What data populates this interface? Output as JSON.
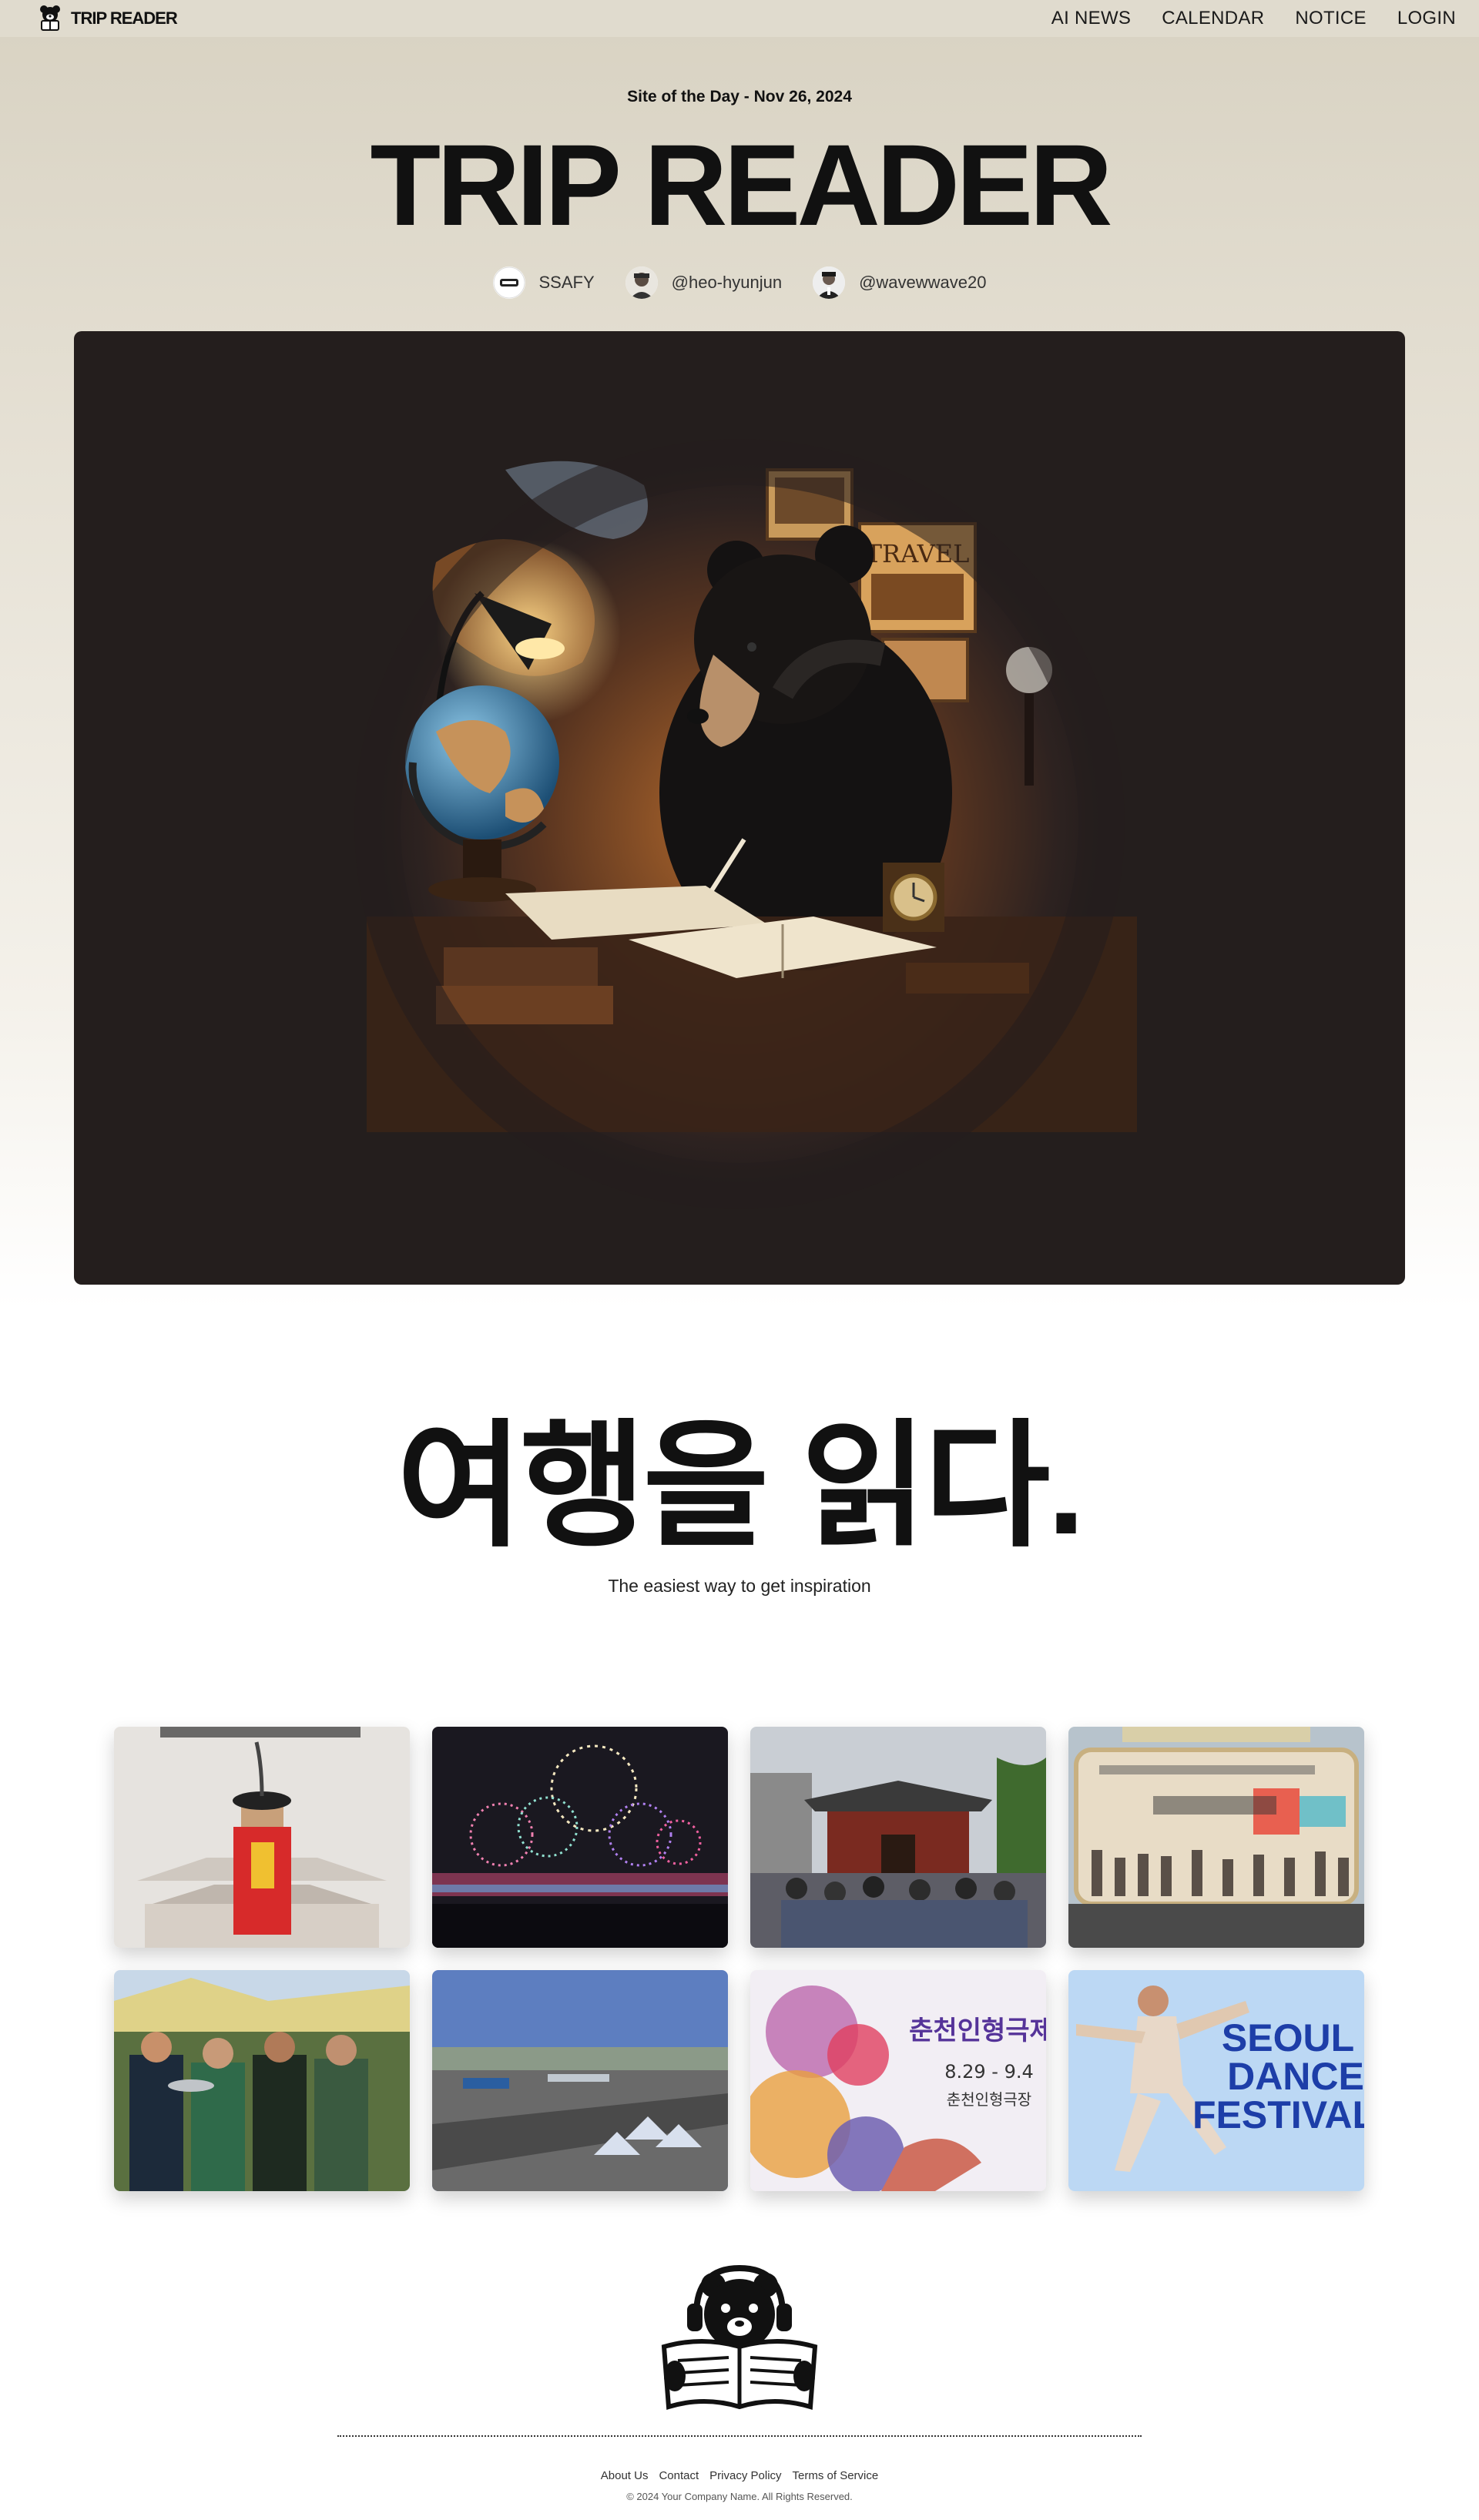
{
  "nav": {
    "brand": "TRIP READER",
    "brand_icon": "bear-reader-icon",
    "links": [
      "AI NEWS",
      "CALENDAR",
      "NOTICE",
      "LOGIN"
    ]
  },
  "hero": {
    "site_of_day": "Site of the Day - Nov 26, 2024",
    "title": "TRIP READER",
    "credits": [
      {
        "name": "SSAFY",
        "avatar": "ssafy-logo"
      },
      {
        "name": "@heo-hyunjun",
        "avatar": "user-photo"
      },
      {
        "name": "@wavewwave20",
        "avatar": "user-photo"
      }
    ],
    "image": {
      "description_icon": "bear-reading-at-desk-illustration",
      "poster_word": "TRAVEL"
    }
  },
  "tagline": {
    "headline": "여행을 읽다.",
    "sub": "The easiest way to get inspiration"
  },
  "gallery": {
    "cards": [
      {
        "icon": "traditional-guard-festival-photo"
      },
      {
        "icon": "fireworks-festival-photo"
      },
      {
        "icon": "palace-gate-crowd-photo"
      },
      {
        "icon": "kids-stage-event-photo"
      },
      {
        "icon": "fishing-festival-photo"
      },
      {
        "icon": "festival-grounds-aerial-photo"
      },
      {
        "icon": "puppet-festival-poster",
        "poster_title": "춘천인형극제",
        "poster_dates": "8.29 - 9.4",
        "poster_venue": "춘천인형극장"
      },
      {
        "icon": "dance-festival-poster",
        "poster_lines": [
          "SEOUL",
          "DANCE",
          "FESTIVAL"
        ]
      }
    ]
  },
  "footer": {
    "logo_icon": "bear-reading-newspaper-logo",
    "links": [
      "About Us",
      "Contact",
      "Privacy Policy",
      "Terms of Service"
    ],
    "copyright": "© 2024 Your Company Name. All Rights Reserved."
  },
  "colors": {
    "hero_bg_top": "#d8d2c2",
    "nav_bg": "#e0dbce",
    "hero_frame_bg": "#241e1d",
    "text": "#111111"
  }
}
